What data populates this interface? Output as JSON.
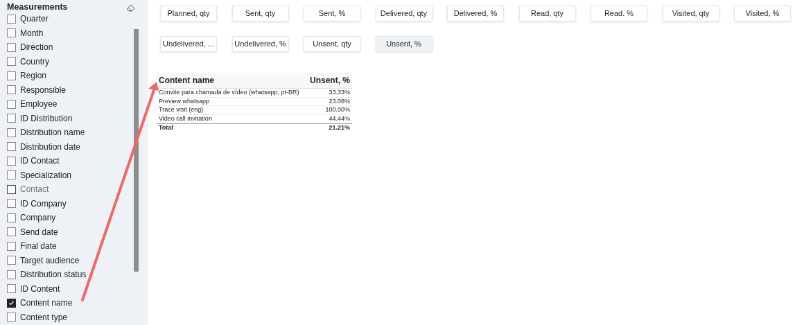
{
  "sidebar": {
    "title": "Measurements",
    "items": [
      {
        "label": "Quarter",
        "checked": false,
        "disabled": false
      },
      {
        "label": "Month",
        "checked": false,
        "disabled": false
      },
      {
        "label": "Direction",
        "checked": false,
        "disabled": false
      },
      {
        "label": "Country",
        "checked": false,
        "disabled": false
      },
      {
        "label": "Region",
        "checked": false,
        "disabled": false
      },
      {
        "label": "Responsible",
        "checked": false,
        "disabled": false
      },
      {
        "label": "Employee",
        "checked": false,
        "disabled": false
      },
      {
        "label": "ID Distribution",
        "checked": false,
        "disabled": false
      },
      {
        "label": "Distribution name",
        "checked": false,
        "disabled": false
      },
      {
        "label": "Distribution date",
        "checked": false,
        "disabled": false
      },
      {
        "label": "ID Contact",
        "checked": false,
        "disabled": false
      },
      {
        "label": "Specialization",
        "checked": false,
        "disabled": false
      },
      {
        "label": "Contact",
        "checked": false,
        "disabled": true
      },
      {
        "label": "ID Company",
        "checked": false,
        "disabled": false
      },
      {
        "label": "Company",
        "checked": false,
        "disabled": false
      },
      {
        "label": "Send date",
        "checked": false,
        "disabled": false
      },
      {
        "label": "Final date",
        "checked": false,
        "disabled": false
      },
      {
        "label": "Target audience",
        "checked": false,
        "disabled": false
      },
      {
        "label": "Distribution status",
        "checked": false,
        "disabled": false
      },
      {
        "label": "ID Content",
        "checked": false,
        "disabled": false
      },
      {
        "label": "Content name",
        "checked": true,
        "disabled": false
      },
      {
        "label": "Content type",
        "checked": false,
        "disabled": false
      }
    ]
  },
  "measure_buttons": [
    [
      {
        "label": "Planned, qty",
        "selected": false
      },
      {
        "label": "Sent, qty",
        "selected": false
      },
      {
        "label": "Sent, %",
        "selected": false
      },
      {
        "label": "Delivered, qty",
        "selected": false
      },
      {
        "label": "Delivered, %",
        "selected": false
      },
      {
        "label": "Read, qty",
        "selected": false
      },
      {
        "label": "Read. %",
        "selected": false
      },
      {
        "label": "Visited, qty",
        "selected": false
      },
      {
        "label": "Visited, %",
        "selected": false
      }
    ],
    [
      {
        "label": "Undelivered, ...",
        "selected": false
      },
      {
        "label": "Undelivered, %",
        "selected": false
      },
      {
        "label": "Unsent, qty",
        "selected": false
      },
      {
        "label": "Unsent, %",
        "selected": true
      }
    ]
  ],
  "table": {
    "columns": [
      "Content name",
      "Unsent, %"
    ],
    "rows": [
      [
        "Convite para chamada de vídeo (whatsapp, pt-BR)",
        "33.33%"
      ],
      [
        "Preview whatsapp",
        "23.08%"
      ],
      [
        "Trace visit (eng)",
        "100.00%"
      ],
      [
        "Video call invitation",
        "44.44%"
      ]
    ],
    "total": [
      "Total",
      "21.21%"
    ]
  }
}
